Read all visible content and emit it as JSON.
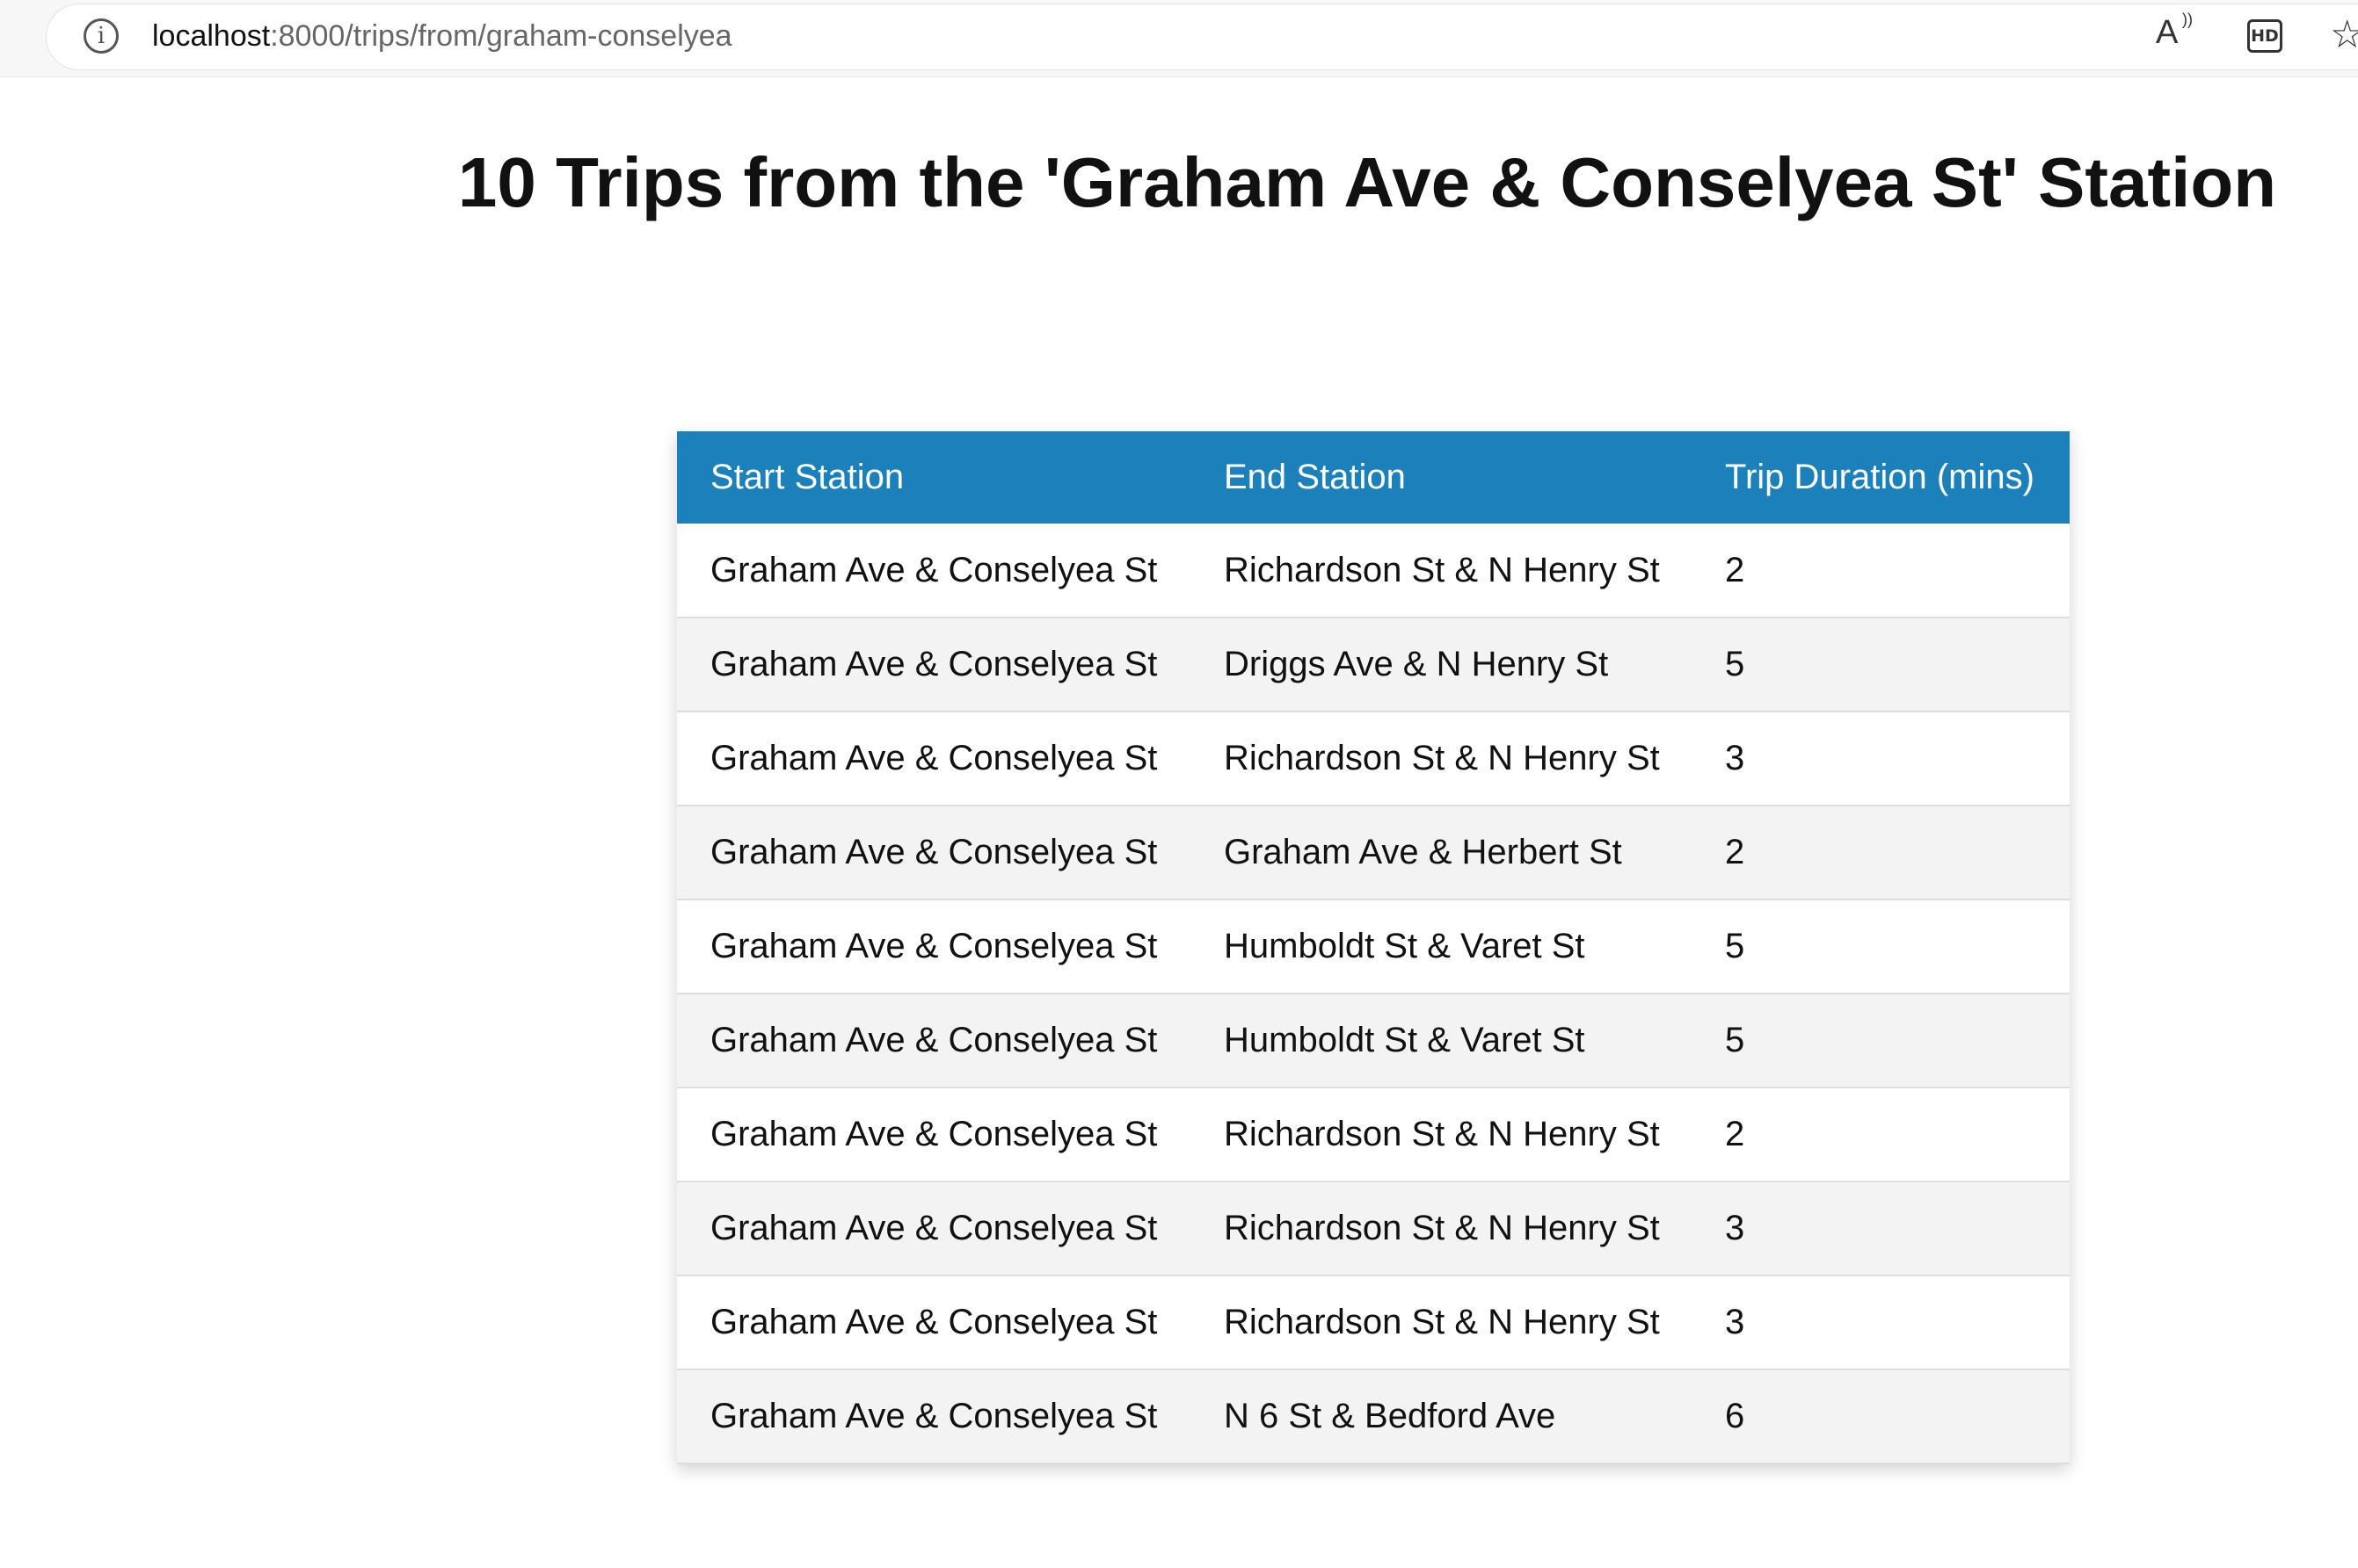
{
  "browser": {
    "url_host": "localhost",
    "url_rest": ":8000/trips/from/graham-conselyea",
    "info_icon": "info-icon",
    "read_aloud_icon": "read-aloud-icon",
    "hd_label": "HD",
    "star_icon": "star-icon"
  },
  "page": {
    "title": "10 Trips from the 'Graham Ave & Conselyea St' Station"
  },
  "table": {
    "header_color": "#1c80bb",
    "columns": [
      "Start Station",
      "End Station",
      "Trip Duration (mins)"
    ],
    "rows": [
      [
        "Graham Ave & Conselyea St",
        "Richardson St & N Henry St",
        "2"
      ],
      [
        "Graham Ave & Conselyea St",
        "Driggs Ave & N Henry St",
        "5"
      ],
      [
        "Graham Ave & Conselyea St",
        "Richardson St & N Henry St",
        "3"
      ],
      [
        "Graham Ave & Conselyea St",
        "Graham Ave & Herbert St",
        "2"
      ],
      [
        "Graham Ave & Conselyea St",
        "Humboldt St & Varet St",
        "5"
      ],
      [
        "Graham Ave & Conselyea St",
        "Humboldt St & Varet St",
        "5"
      ],
      [
        "Graham Ave & Conselyea St",
        "Richardson St & N Henry St",
        "2"
      ],
      [
        "Graham Ave & Conselyea St",
        "Richardson St & N Henry St",
        "3"
      ],
      [
        "Graham Ave & Conselyea St",
        "Richardson St & N Henry St",
        "3"
      ],
      [
        "Graham Ave & Conselyea St",
        "N 6 St & Bedford Ave",
        "6"
      ]
    ]
  }
}
